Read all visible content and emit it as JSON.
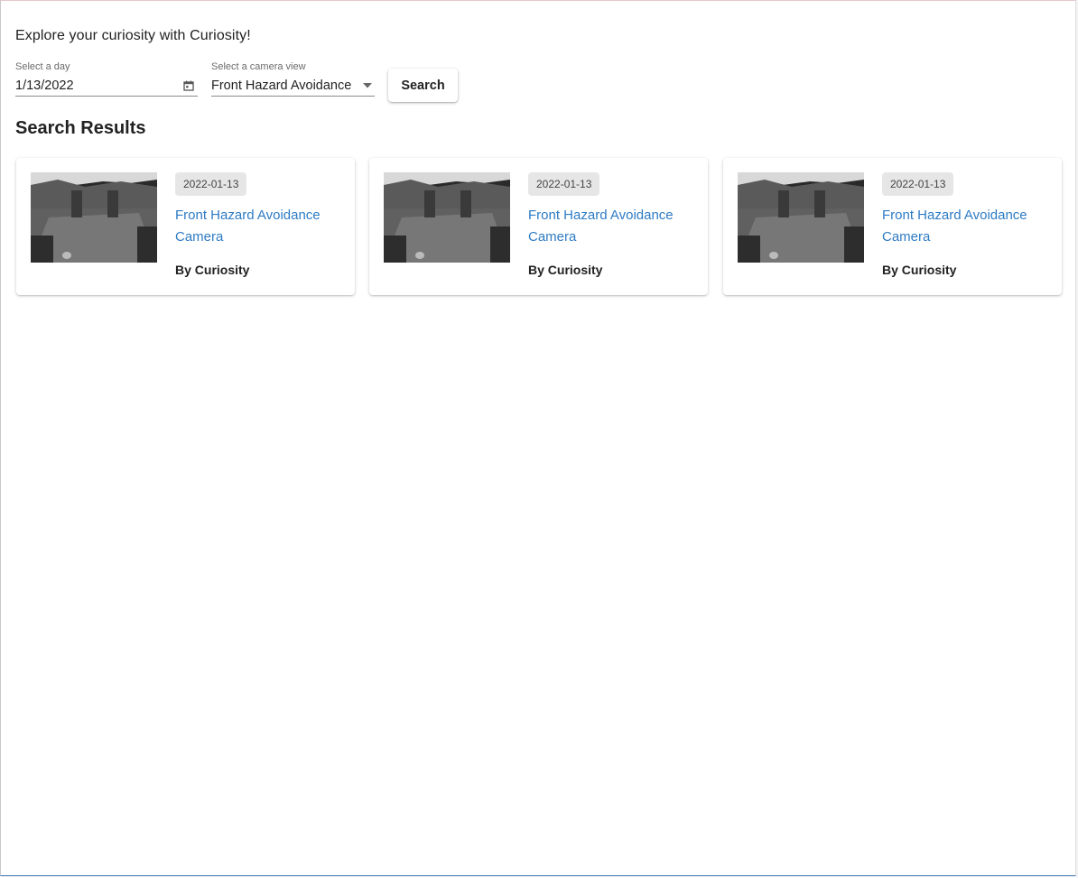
{
  "header": {
    "headline": "Explore your curiosity with Curiosity!"
  },
  "filters": {
    "date_label": "Select a day",
    "date_value": "1/13/2022",
    "camera_label": "Select a camera view",
    "camera_value": "Front Hazard Avoidance",
    "search_label": "Search"
  },
  "results": {
    "title": "Search Results",
    "items": [
      {
        "date": "2022-01-13",
        "camera": "Front Hazard Avoidance Camera",
        "byline": "By Curiosity"
      },
      {
        "date": "2022-01-13",
        "camera": "Front Hazard Avoidance Camera",
        "byline": "By Curiosity"
      },
      {
        "date": "2022-01-13",
        "camera": "Front Hazard Avoidance Camera",
        "byline": "By Curiosity"
      }
    ]
  },
  "icons": {
    "date_picker": "calendar-icon",
    "dropdown": "caret-down-icon"
  },
  "colors": {
    "link": "#2e7bc4",
    "chip_bg": "#e6e6e6"
  }
}
